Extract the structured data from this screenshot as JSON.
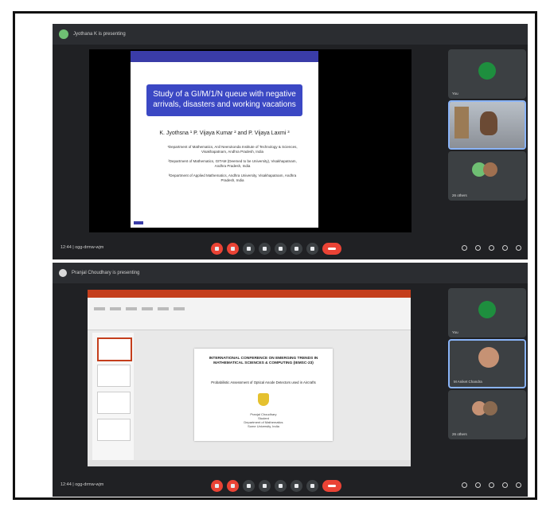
{
  "panel1": {
    "presenting": "Jyothana K is presenting",
    "slide": {
      "title": "Study of a GI/M/1/N queue with negative arrivals, disasters and working vacations",
      "authors": "K. Jyothsna ¹ P. Vijaya Kumar ² and P. Vijaya Laxmi ³",
      "affiliations": [
        "¹Department of Mathematics, Anil Neerukonda Institute of Technology & Sciences, Visakhapatnam, Andhra Pradesh, India",
        "²Department of Mathematics, GITAM (Deemed to be University), Visakhapatnam, Andhra Pradesh, India",
        "³Department of Applied Mathematics, Andhra University, Visakhapatnam, Andhra Pradesh, India"
      ]
    },
    "tiles": [
      {
        "name": "You"
      },
      {
        "name": ""
      },
      {
        "name": "26 others"
      }
    ],
    "time": "12:44 | ogg-drmw-wjm"
  },
  "panel2": {
    "presenting": "Pranjal Choudhary is presenting",
    "slide": {
      "title": "INTERNATIONAL CONFERENCE ON EMERGING TRENDS IN MATHEMATICAL SCIENCES & COMPUTING (IEMSC-23)",
      "subtitle": "Probabilistic Assessment of Optical Anode Detectors used in Aircrafts",
      "author": "Pranjal Choudhary\nStudent\nDepartment of Mathematics\nSome University, India"
    },
    "tiles": [
      {
        "name": "You"
      },
      {
        "name": "M Aniket Chandra"
      },
      {
        "name": "26 others"
      }
    ],
    "time": "12:44 | ogg-drmw-wjm"
  },
  "icons": [
    "mic-off-icon",
    "camera-off-icon",
    "captions-icon",
    "hand-icon",
    "emoji-icon",
    "present-icon",
    "more-icon",
    "hangup-icon",
    "info-icon",
    "people-icon",
    "chat-icon",
    "activities-icon",
    "lock-icon"
  ],
  "colors": {
    "meet_bg": "#202124",
    "red": "#ea4335",
    "green": "#1e8e3e",
    "slide_blue": "#3b48c4",
    "pp_orange": "#c43e1c"
  }
}
